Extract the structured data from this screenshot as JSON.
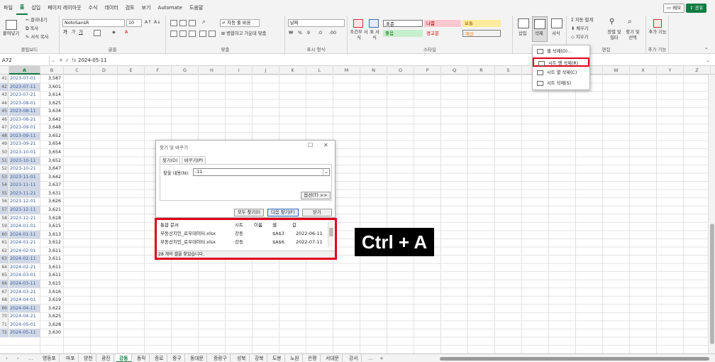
{
  "menu": {
    "tabs": [
      "파일",
      "홈",
      "삽입",
      "페이지 레이아웃",
      "수식",
      "데이터",
      "검토",
      "보기",
      "Automate",
      "도움말"
    ],
    "memo": "메모",
    "share": "공유"
  },
  "ribbon": {
    "clipboard": {
      "label": "클립보드",
      "paste": "붙여넣기",
      "cut": "잘라내기",
      "copy": "복사",
      "format_painter": "서식 복사"
    },
    "font": {
      "label": "글꼴",
      "font_name": "NotoSansR",
      "font_size": "10",
      "bold": "가",
      "italic": "가",
      "underline": "가"
    },
    "align": {
      "label": "맞춤",
      "wrap": "자동 줄 바꿈",
      "merge": "병합하고 가운데 맞춤"
    },
    "number": {
      "label": "표시 형식",
      "format": "날짜"
    },
    "styles": {
      "label": "스타일",
      "conditional": "조건부 서식",
      "table": "표 서식",
      "cell_styles": [
        "표준",
        "나쁨",
        "보통",
        "좋음",
        "경고문",
        "계산"
      ]
    },
    "cells": {
      "label": "셀",
      "insert": "삽입",
      "delete": "삭제",
      "format": "서식"
    },
    "editing": {
      "label": "편집",
      "autosum": "자동 합계",
      "fill": "채우기",
      "clear": "지우기",
      "sort": "정렬 및 필터",
      "find": "찾기 및 선택"
    },
    "addins": {
      "label": "추가 기능",
      "button": "추가 기능"
    }
  },
  "formula": {
    "cell": "A72",
    "value": "2024-05-11"
  },
  "columns": [
    "A",
    "B",
    "C",
    "D",
    "E",
    "F",
    "G",
    "H",
    "I",
    "J",
    "K",
    "L",
    "M",
    "N",
    "O",
    "P",
    "Q",
    "R",
    "S",
    "T",
    "U",
    "V",
    "W",
    "X",
    "Y",
    "Z"
  ],
  "rows": [
    {
      "n": "41",
      "a": "2023-07-01",
      "b": "3,587",
      "hl": false
    },
    {
      "n": "42",
      "a": "2023-07-11",
      "b": "3,601",
      "hl": true
    },
    {
      "n": "43",
      "a": "2023-07-21",
      "b": "3,614",
      "hl": false
    },
    {
      "n": "44",
      "a": "2023-08-01",
      "b": "3,625",
      "hl": false
    },
    {
      "n": "45",
      "a": "2023-08-11",
      "b": "3,634",
      "hl": true
    },
    {
      "n": "46",
      "a": "2023-08-21",
      "b": "3,642",
      "hl": false
    },
    {
      "n": "47",
      "a": "2023-09-01",
      "b": "3,648",
      "hl": false
    },
    {
      "n": "48",
      "a": "2023-09-11",
      "b": "3,652",
      "hl": true
    },
    {
      "n": "49",
      "a": "2023-09-21",
      "b": "3,654",
      "hl": false
    },
    {
      "n": "50",
      "a": "2023-10-01",
      "b": "3,654",
      "hl": false
    },
    {
      "n": "51",
      "a": "2023-10-11",
      "b": "3,652",
      "hl": true
    },
    {
      "n": "52",
      "a": "2023-10-21",
      "b": "3,647",
      "hl": false
    },
    {
      "n": "53",
      "a": "2023-11-01",
      "b": "3,642",
      "hl": true
    },
    {
      "n": "54",
      "a": "2023-11-11",
      "b": "3,637",
      "hl": true
    },
    {
      "n": "55",
      "a": "2023-11-21",
      "b": "3,631",
      "hl": true
    },
    {
      "n": "56",
      "a": "2023-12-01",
      "b": "3,626",
      "hl": false
    },
    {
      "n": "57",
      "a": "2023-12-11",
      "b": "3,621",
      "hl": true
    },
    {
      "n": "58",
      "a": "2023-12-21",
      "b": "3,618",
      "hl": false
    },
    {
      "n": "59",
      "a": "2024-01-01",
      "b": "3,615",
      "hl": false
    },
    {
      "n": "60",
      "a": "2024-01-11",
      "b": "3,613",
      "hl": true
    },
    {
      "n": "61",
      "a": "2024-01-21",
      "b": "3,612",
      "hl": false
    },
    {
      "n": "62",
      "a": "2024-02-01",
      "b": "3,611",
      "hl": false
    },
    {
      "n": "63",
      "a": "2024-02-11",
      "b": "3,611",
      "hl": true
    },
    {
      "n": "64",
      "a": "2024-02-21",
      "b": "3,611",
      "hl": false
    },
    {
      "n": "65",
      "a": "2024-03-01",
      "b": "3,611",
      "hl": false
    },
    {
      "n": "66",
      "a": "2024-03-11",
      "b": "3,615",
      "hl": true
    },
    {
      "n": "67",
      "a": "2024-03-21",
      "b": "3,616",
      "hl": false
    },
    {
      "n": "68",
      "a": "2024-04-01",
      "b": "3,619",
      "hl": false
    },
    {
      "n": "69",
      "a": "2024-04-11",
      "b": "3,622",
      "hl": true
    },
    {
      "n": "70",
      "a": "2024-04-21",
      "b": "3,625",
      "hl": false
    },
    {
      "n": "71",
      "a": "2024-05-01",
      "b": "3,628",
      "hl": false
    },
    {
      "n": "72",
      "a": "2024-05-11",
      "b": "3,630",
      "hl": true
    }
  ],
  "delete_menu": {
    "items": [
      "셀 삭제(D)...",
      "시트 행 삭제(R)",
      "시트 열 삭제(C)",
      "시트 삭제(S)"
    ],
    "selected_index": 1
  },
  "dialog": {
    "title": "찾기 및 바꾸기",
    "tabs": [
      "찾기(D)",
      "바꾸기(P)"
    ],
    "find_label": "찾을 내용(N):",
    "find_value": "-11",
    "options_btn": "옵션(T) >>",
    "find_all_btn": "모두 찾기(I)",
    "find_next_btn": "다음 찾기(F)",
    "close_btn": "닫기"
  },
  "results": {
    "headers": [
      "통합 문서",
      "시트",
      "이름",
      "셀",
      "값"
    ],
    "rows": [
      [
        "부동산지인_로우데이터.xlsx",
        "강동",
        "",
        "$A$3",
        "2022-06-11"
      ],
      [
        "부동산지인_로우데이터.xlsx",
        "강동",
        "",
        "$A$6",
        "2022-07-11"
      ]
    ],
    "status": "28 개의 셀을 찾았습니다."
  },
  "shortcut": "Ctrl + A",
  "sheets": {
    "tabs": [
      "영등포",
      "마포",
      "양천",
      "광진",
      "강동",
      "동작",
      "종로",
      "중구",
      "동대문",
      "중랑구",
      "성북",
      "강북",
      "도봉",
      "노원",
      "은평",
      "서대문",
      "강서"
    ],
    "active_index": 4
  }
}
